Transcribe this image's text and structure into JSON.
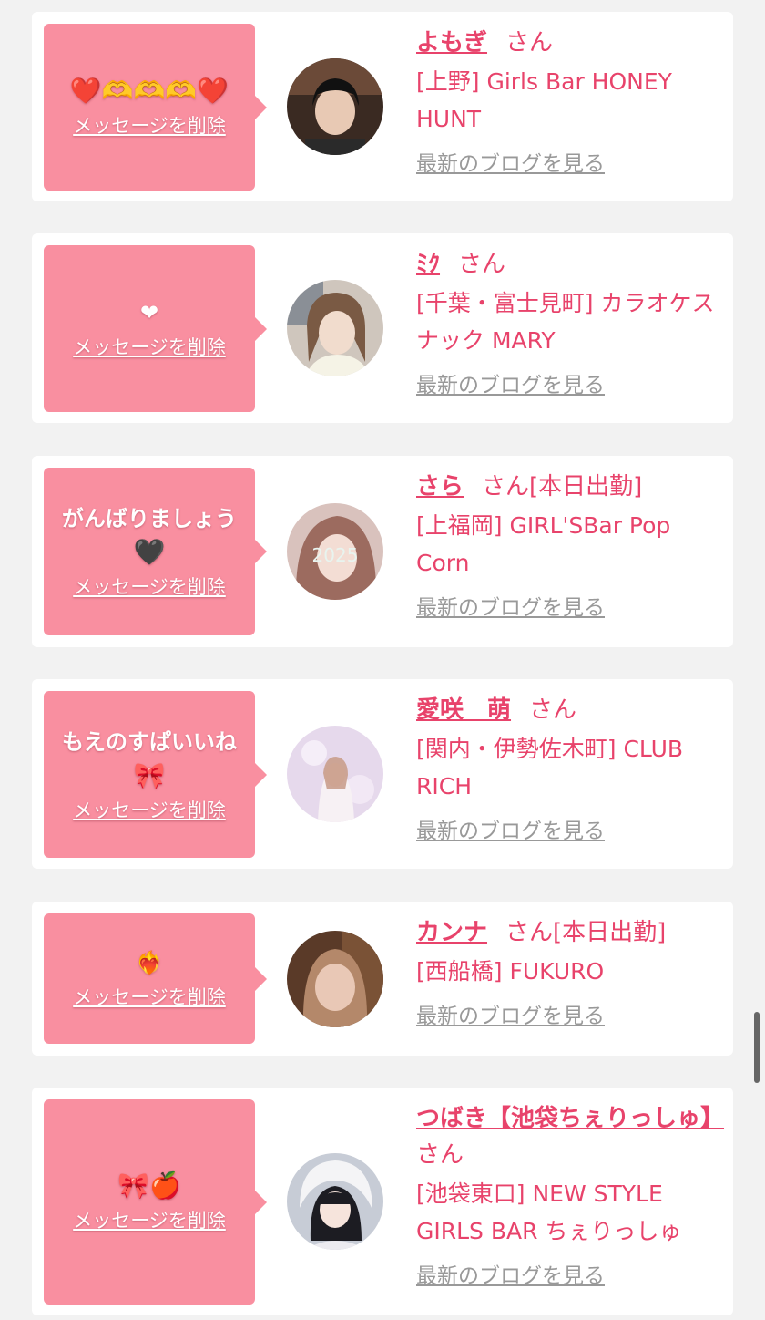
{
  "delete_label": "メッセージを削除",
  "blog_label": "最新のブログを見る",
  "entries": [
    {
      "message": "",
      "emoji": "❤️🫶🫶🫶❤️",
      "name": "よもぎ",
      "suffix": "さん",
      "status": "",
      "shop": "[上野] Girls Bar HONEY HUNT"
    },
    {
      "message": "",
      "emoji": "❤",
      "name": "ﾐｸ",
      "suffix": "さん",
      "status": "",
      "shop": "[千葉・富士見町] カラオケスナック MARY"
    },
    {
      "message": "がんばりましょう",
      "emoji": "🖤",
      "name": "さら",
      "suffix": "さん",
      "status": "[本日出勤]",
      "shop": "[上福岡] GIRL'SBar Pop Corn"
    },
    {
      "message": "もえのすぱいいね",
      "emoji": "🎀",
      "name": "愛咲　萌",
      "suffix": "さん",
      "status": "",
      "shop": "[関内・伊勢佐木町] CLUB RICH"
    },
    {
      "message": "",
      "emoji": "❤️‍🔥",
      "name": "カンナ",
      "suffix": "さん",
      "status": "[本日出勤]",
      "shop": "[西船橋] FUKURO"
    },
    {
      "message": "",
      "emoji": "🎀🍎",
      "name": "つばき【池袋ちぇりっしゅ】",
      "suffix": "さん",
      "status": "",
      "shop": "[池袋東口] NEW STYLE GIRLS BAR ちぇりっしゅ"
    }
  ]
}
